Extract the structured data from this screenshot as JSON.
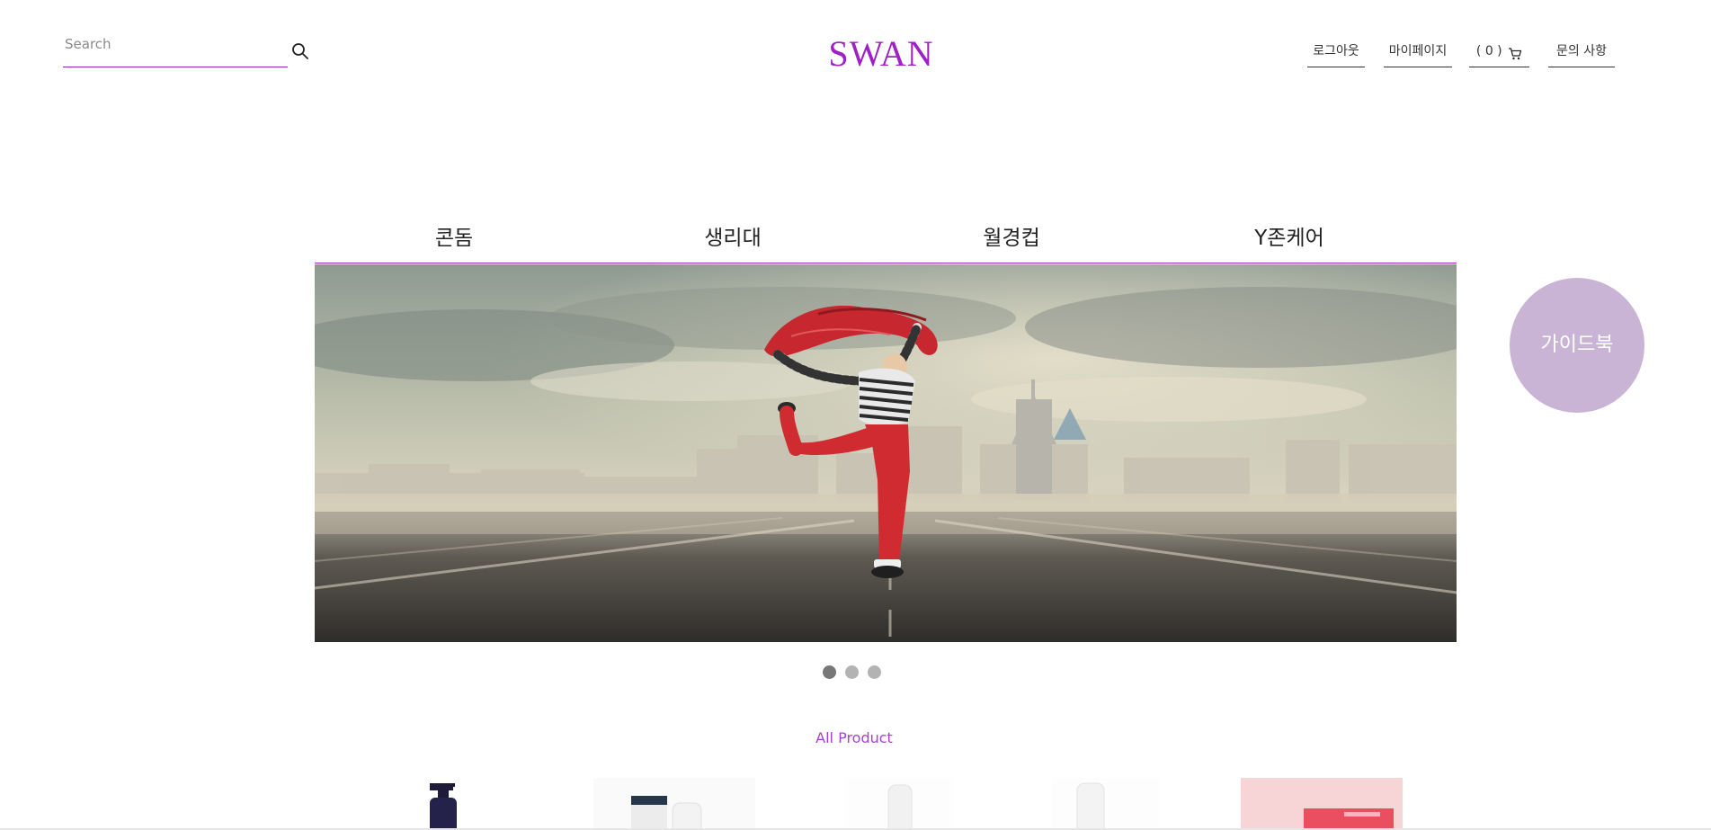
{
  "header": {
    "search": {
      "placeholder": "Search",
      "value": ""
    },
    "logo": "SWAN",
    "nav": {
      "logout": "로그아웃",
      "mypage": "마이페이지",
      "cart": "( 0 )",
      "inquiry": "문의 사항"
    }
  },
  "categories": [
    "콘돔",
    "생리대",
    "월경컵",
    "Y존케어"
  ],
  "guidebook": "가이드북",
  "carousel": {
    "slides": 3,
    "active": 1
  },
  "products": {
    "title": "All Product"
  },
  "colors": {
    "accent": "#a020c8",
    "guidebook_bg": "#c9b4d5",
    "product_title": "#a540d8"
  }
}
